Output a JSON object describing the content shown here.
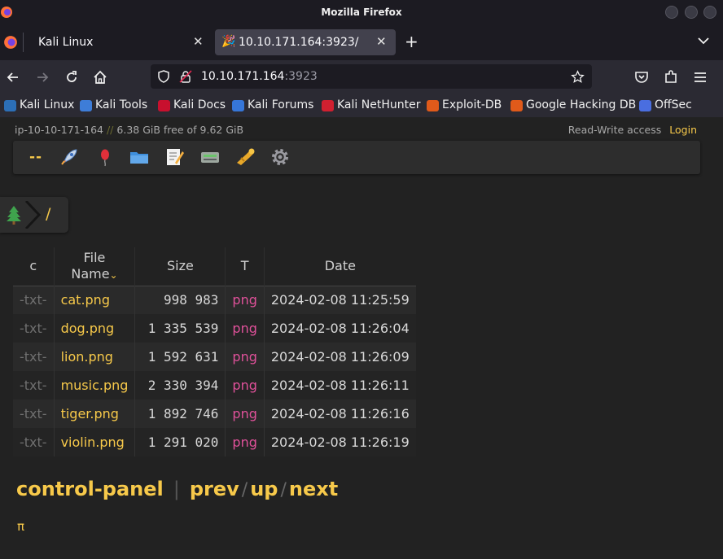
{
  "window": {
    "title": "Mozilla Firefox"
  },
  "tabs": [
    {
      "label": "Kali Linux",
      "active": false
    },
    {
      "label": "10.10.171.164:3923/",
      "active": true
    }
  ],
  "urlbar": {
    "host": "10.10.171.164",
    "port": ":3923"
  },
  "bookmarks": [
    {
      "label": "Kali Linux",
      "icon": "kali-dragon-icon"
    },
    {
      "label": "Kali Tools",
      "icon": "kali-tools-icon"
    },
    {
      "label": "Kali Docs",
      "icon": "kali-docs-icon"
    },
    {
      "label": "Kali Forums",
      "icon": "kali-forums-icon"
    },
    {
      "label": "Kali NetHunter",
      "icon": "nethunter-icon"
    },
    {
      "label": "Exploit-DB",
      "icon": "exploit-db-icon"
    },
    {
      "label": "Google Hacking DB",
      "icon": "ghdb-icon"
    },
    {
      "label": "OffSec",
      "icon": "offsec-icon"
    }
  ],
  "server": {
    "hostname": "ip-10-10-171-164",
    "separator": "//",
    "disk": "6.38 GiB free of 9.62 GiB",
    "access": "Read-Write access",
    "login": "Login"
  },
  "ops": {
    "dash": "--"
  },
  "breadcrumb": {
    "root": "/"
  },
  "table": {
    "headers": {
      "c": "c",
      "name_line1": "File",
      "name_line2": "Name",
      "sort": "⌄",
      "size": "Size",
      "type": "T",
      "date": "Date"
    },
    "rows": [
      {
        "c": "-txt-",
        "name": "cat.png",
        "size": "998 983",
        "type": "png",
        "date": "2024-02-08 11:25:59"
      },
      {
        "c": "-txt-",
        "name": "dog.png",
        "size": "1 335 539",
        "type": "png",
        "date": "2024-02-08 11:26:04"
      },
      {
        "c": "-txt-",
        "name": "lion.png",
        "size": "1 592 631",
        "type": "png",
        "date": "2024-02-08 11:26:09"
      },
      {
        "c": "-txt-",
        "name": "music.png",
        "size": "2 330 394",
        "type": "png",
        "date": "2024-02-08 11:26:11"
      },
      {
        "c": "-txt-",
        "name": "tiger.png",
        "size": "1 892 746",
        "type": "png",
        "date": "2024-02-08 11:26:16"
      },
      {
        "c": "-txt-",
        "name": "violin.png",
        "size": "1 291 020",
        "type": "png",
        "date": "2024-02-08 11:26:19"
      }
    ]
  },
  "footer": {
    "control_panel": "control-panel",
    "bar": "|",
    "prev": "prev",
    "up": "up",
    "next": "next",
    "slash": "/",
    "pi": "π"
  },
  "colors": {
    "accent": "#f7c94a",
    "type": "#e0519a",
    "background": "#222222"
  }
}
